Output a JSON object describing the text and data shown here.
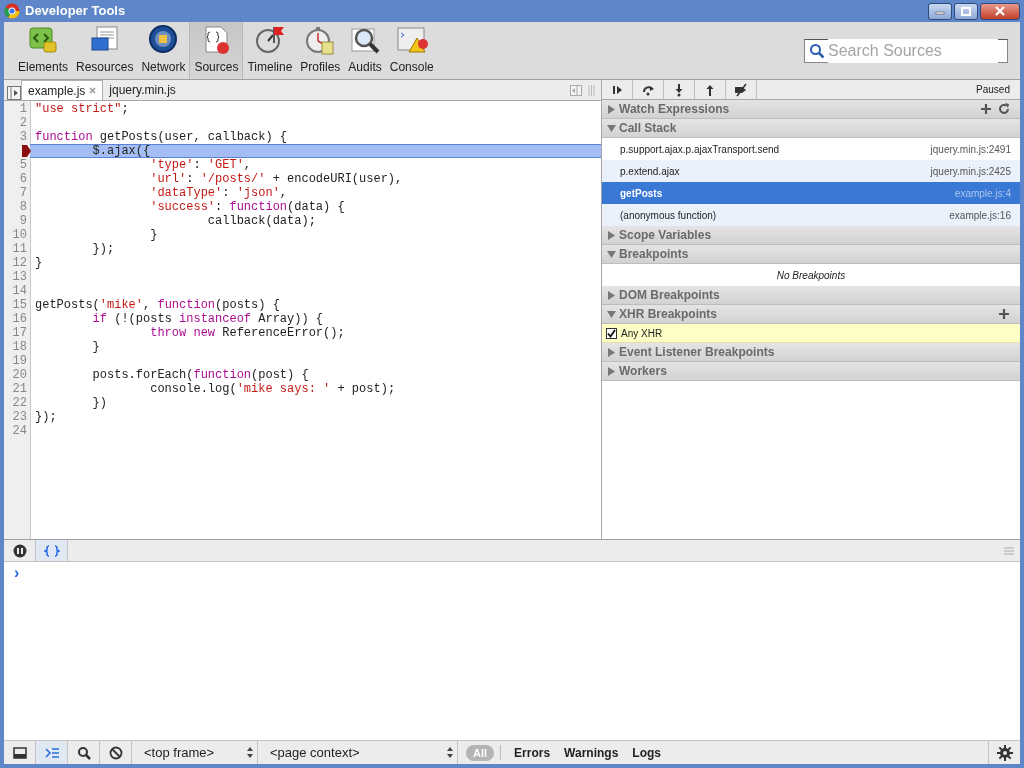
{
  "window": {
    "title": "Developer Tools"
  },
  "toolbar": {
    "tabs": [
      {
        "label": "Elements",
        "selected": false
      },
      {
        "label": "Resources",
        "selected": false
      },
      {
        "label": "Network",
        "selected": false
      },
      {
        "label": "Sources",
        "selected": true
      },
      {
        "label": "Timeline",
        "selected": false
      },
      {
        "label": "Profiles",
        "selected": false
      },
      {
        "label": "Audits",
        "selected": false
      },
      {
        "label": "Console",
        "selected": false
      }
    ]
  },
  "search": {
    "placeholder": "Search Sources"
  },
  "file_tabs": [
    {
      "label": "example.js",
      "selected": true,
      "closable": true
    },
    {
      "label": "jquery.min.js",
      "selected": false,
      "closable": false
    }
  ],
  "code": {
    "lines": [
      {
        "number": "1",
        "tokens": [
          {
            "kind": "string",
            "text": "\"use strict\""
          },
          {
            "kind": "plain",
            "text": ";"
          }
        ]
      },
      {
        "number": "2"
      },
      {
        "number": "3",
        "tokens": [
          {
            "kind": "keyword",
            "text": "function"
          },
          {
            "kind": "plain",
            "text": " getPosts(user, callback) {"
          }
        ]
      },
      {
        "breakpoint": true,
        "current": true,
        "tokens": [
          {
            "kind": "plain",
            "text": "\t$.ajax({"
          }
        ]
      },
      {
        "number": "5",
        "tokens": [
          {
            "kind": "string",
            "text": "\t\t'type'"
          },
          {
            "kind": "plain",
            "text": ": "
          },
          {
            "kind": "string",
            "text": "'GET'"
          },
          {
            "kind": "plain",
            "text": ","
          }
        ]
      },
      {
        "number": "6",
        "tokens": [
          {
            "kind": "string",
            "text": "\t\t'url'"
          },
          {
            "kind": "plain",
            "text": ": "
          },
          {
            "kind": "string",
            "text": "'/posts/'"
          },
          {
            "kind": "plain",
            "text": " + encodeURI(user),"
          }
        ]
      },
      {
        "number": "7",
        "tokens": [
          {
            "kind": "string",
            "text": "\t\t'dataType'"
          },
          {
            "kind": "plain",
            "text": ": "
          },
          {
            "kind": "string",
            "text": "'json'"
          },
          {
            "kind": "plain",
            "text": ","
          }
        ]
      },
      {
        "number": "8",
        "tokens": [
          {
            "kind": "string",
            "text": "\t\t'success'"
          },
          {
            "kind": "plain",
            "text": ": "
          },
          {
            "kind": "keyword",
            "text": "function"
          },
          {
            "kind": "plain",
            "text": "(data) {"
          }
        ]
      },
      {
        "number": "9",
        "tokens": [
          {
            "kind": "plain",
            "text": "\t\t\tcallback(data);"
          }
        ]
      },
      {
        "number": "10",
        "tokens": [
          {
            "kind": "plain",
            "text": "\t\t}"
          }
        ]
      },
      {
        "number": "11",
        "tokens": [
          {
            "kind": "plain",
            "text": "\t});"
          }
        ]
      },
      {
        "number": "12",
        "tokens": [
          {
            "kind": "plain",
            "text": "}"
          }
        ]
      },
      {
        "number": "13"
      },
      {
        "number": "14"
      },
      {
        "number": "15",
        "tokens": [
          {
            "kind": "plain",
            "text": "getPosts("
          },
          {
            "kind": "string",
            "text": "'mike'"
          },
          {
            "kind": "plain",
            "text": ", "
          },
          {
            "kind": "keyword",
            "text": "function"
          },
          {
            "kind": "plain",
            "text": "(posts) {"
          }
        ]
      },
      {
        "number": "16",
        "tokens": [
          {
            "kind": "keyword",
            "text": "\tif"
          },
          {
            "kind": "plain",
            "text": " (!(posts "
          },
          {
            "kind": "keyword",
            "text": "instanceof"
          },
          {
            "kind": "plain",
            "text": " Array)) {"
          }
        ]
      },
      {
        "number": "17",
        "tokens": [
          {
            "kind": "keyword",
            "text": "\t\tthrow new"
          },
          {
            "kind": "plain",
            "text": " ReferenceError();"
          }
        ]
      },
      {
        "number": "18",
        "tokens": [
          {
            "kind": "plain",
            "text": "\t}"
          }
        ]
      },
      {
        "number": "19"
      },
      {
        "number": "20",
        "tokens": [
          {
            "kind": "plain",
            "text": "\tposts.forEach("
          },
          {
            "kind": "keyword",
            "text": "function"
          },
          {
            "kind": "plain",
            "text": "(post) {"
          }
        ]
      },
      {
        "number": "21",
        "tokens": [
          {
            "kind": "plain",
            "text": "\t\tconsole.log("
          },
          {
            "kind": "string",
            "text": "'mike says: '"
          },
          {
            "kind": "plain",
            "text": " + post);"
          }
        ]
      },
      {
        "number": "22",
        "tokens": [
          {
            "kind": "plain",
            "text": "\t})"
          }
        ]
      },
      {
        "number": "23",
        "tokens": [
          {
            "kind": "plain",
            "text": "});"
          }
        ]
      },
      {
        "number": "24"
      }
    ]
  },
  "debugger": {
    "status": "Paused",
    "sections": [
      {
        "kind": "watch",
        "title": "Watch Expressions",
        "expanded": false
      },
      {
        "kind": "callstack",
        "title": "Call Stack",
        "expanded": true,
        "frames": [
          {
            "name": "p.support.ajax.p.ajaxTransport.send",
            "location": "jquery.min.js:2491",
            "selected": false
          },
          {
            "name": "p.extend.ajax",
            "location": "jquery.min.js:2425",
            "selected": false
          },
          {
            "name": "getPosts",
            "location": "example.js:4",
            "selected": true
          },
          {
            "name": "(anonymous function)",
            "location": "example.js:16",
            "selected": false
          }
        ]
      },
      {
        "kind": "plain",
        "title": "Scope Variables",
        "expanded": false
      },
      {
        "kind": "breakpoints",
        "title": "Breakpoints",
        "expanded": true,
        "empty_message": "No Breakpoints"
      },
      {
        "kind": "plain",
        "title": "DOM Breakpoints",
        "expanded": false
      },
      {
        "kind": "xhr",
        "title": "XHR Breakpoints",
        "expanded": true,
        "items": [
          {
            "label": "Any XHR",
            "checked": true
          }
        ]
      },
      {
        "kind": "plain",
        "title": "Event Listener Breakpoints",
        "expanded": false
      },
      {
        "kind": "plain",
        "title": "Workers",
        "expanded": false
      }
    ]
  },
  "console": {
    "prompt": "›"
  },
  "bottom_bar": {
    "frame_select": "<top frame>",
    "context_select": "<page context>",
    "filters": [
      {
        "label": "All",
        "selected": true
      },
      {
        "label": "Errors",
        "selected": false
      },
      {
        "label": "Warnings",
        "selected": false
      },
      {
        "label": "Logs",
        "selected": false
      }
    ]
  }
}
